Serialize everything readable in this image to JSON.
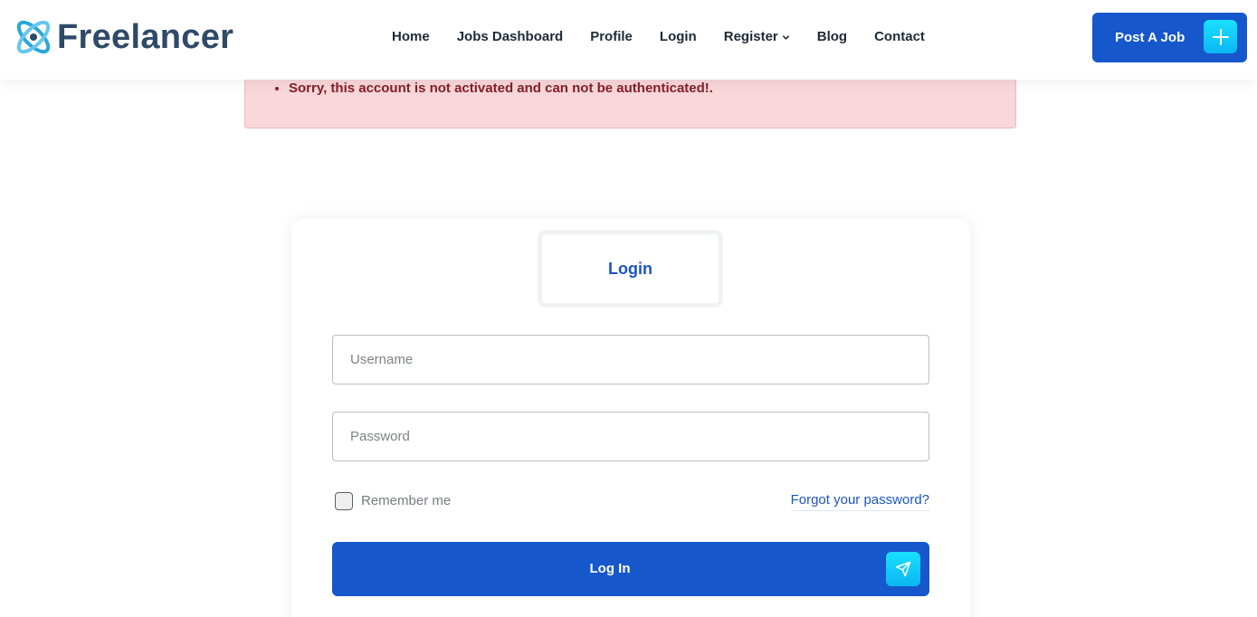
{
  "brand": {
    "name": "Freelancer",
    "logo_icon": "orbit-logo-icon"
  },
  "nav": {
    "items": [
      {
        "label": "Home"
      },
      {
        "label": "Jobs Dashboard"
      },
      {
        "label": "Profile"
      },
      {
        "label": "Login"
      },
      {
        "label": "Register",
        "has_dropdown": true
      },
      {
        "label": "Blog"
      },
      {
        "label": "Contact"
      }
    ]
  },
  "header_action": {
    "label": "Post A Job",
    "icon": "plus-icon"
  },
  "alert": {
    "messages": [
      "Sorry, this account is not activated and can not be authenticated!."
    ]
  },
  "login_form": {
    "tab_label": "Login",
    "username_placeholder": "Username",
    "username_value": "",
    "password_placeholder": "Password",
    "password_value": "",
    "remember_label": "Remember me",
    "remember_checked": false,
    "forgot_label": "Forgot your password?",
    "submit_label": "Log In",
    "submit_icon": "send-icon"
  },
  "colors": {
    "primary": "#1657cc",
    "accent": "#19e0ff",
    "alert_bg": "#f8d7da",
    "alert_text": "#842029",
    "brand_text": "#2f4a68"
  }
}
